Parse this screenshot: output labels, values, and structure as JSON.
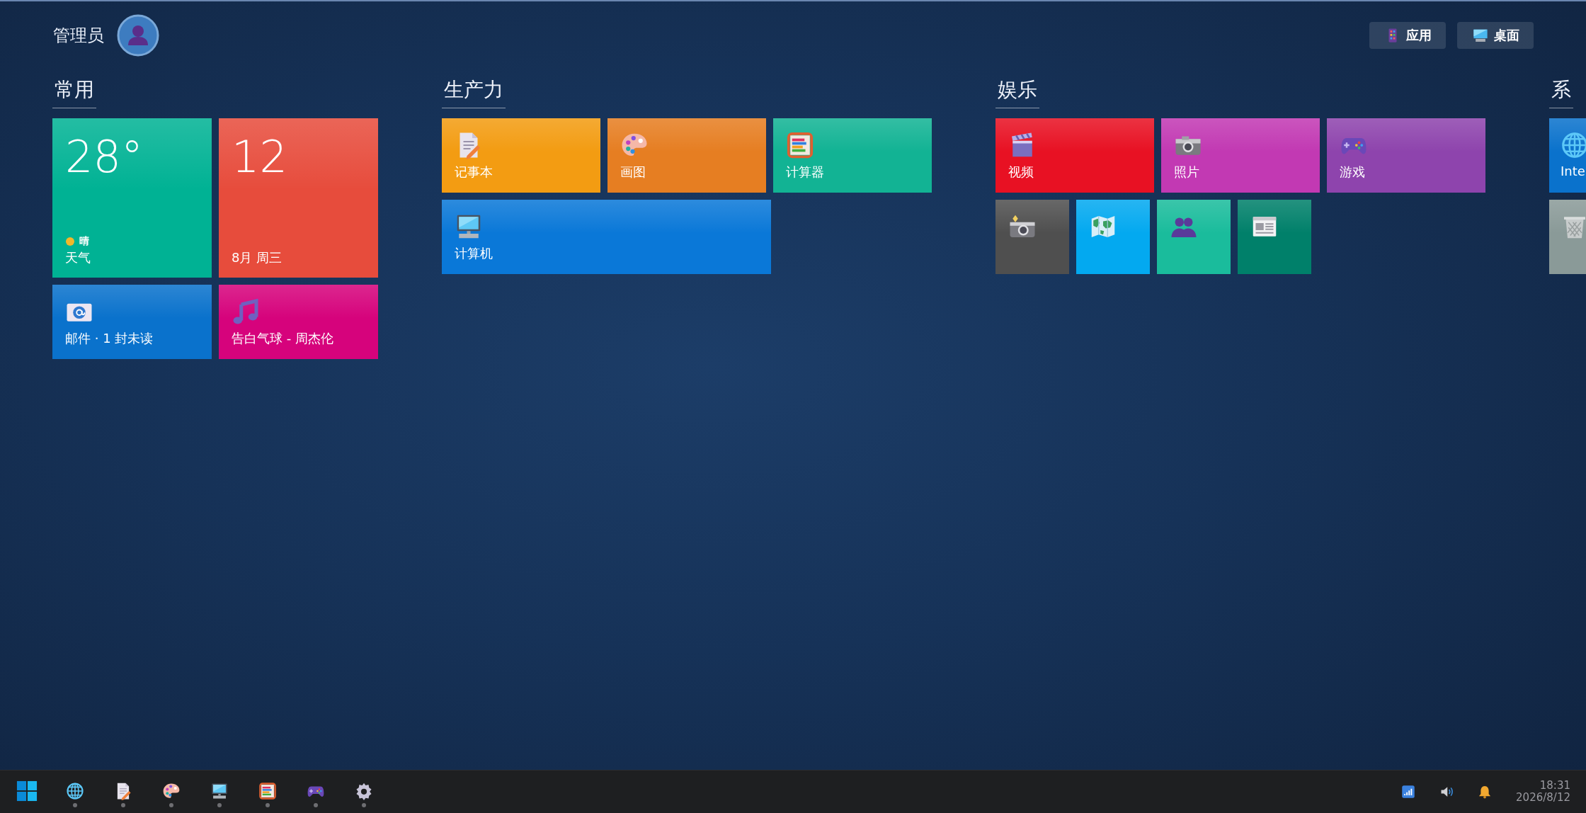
{
  "user": {
    "name": "管理员"
  },
  "top_buttons": [
    {
      "label": "应用",
      "kind": "apps"
    },
    {
      "label": "桌面",
      "kind": "desktop"
    }
  ],
  "groups": [
    {
      "title": "常用",
      "tiles": [
        {
          "kind": "weather",
          "tall": true,
          "double": false,
          "small": false,
          "color": "#00b294",
          "temperature": "28°",
          "condition": "晴",
          "label": "天气"
        },
        {
          "kind": "calendar",
          "tall": true,
          "double": false,
          "small": false,
          "color": "#e74c3c",
          "day": "12",
          "label": "8月 周三"
        },
        {
          "kind": "mail",
          "tall": false,
          "double": false,
          "small": false,
          "color": "#0a72cc",
          "label": "邮件 · 1 封未读"
        },
        {
          "kind": "music",
          "tall": false,
          "double": false,
          "small": false,
          "color": "#d6037c",
          "label": "告白气球 - 周杰伦"
        }
      ]
    },
    {
      "title": "生产力",
      "tiles": [
        {
          "kind": "notepad",
          "tall": false,
          "double": false,
          "small": false,
          "color": "#f39c12",
          "label": "记事本"
        },
        {
          "kind": "palette",
          "tall": false,
          "double": false,
          "small": false,
          "color": "#e67e22",
          "label": "画图"
        },
        {
          "kind": "abacus",
          "tall": false,
          "double": false,
          "small": false,
          "color": "#12b394",
          "label": "计算器"
        },
        {
          "kind": "computer",
          "tall": false,
          "double": true,
          "small": false,
          "color": "#0a78d8",
          "label": "计算机"
        }
      ]
    },
    {
      "title": "娱乐",
      "tiles": [
        {
          "kind": "clapper",
          "tall": false,
          "double": false,
          "small": false,
          "color": "#e81123",
          "label": "视频"
        },
        {
          "kind": "camera",
          "tall": false,
          "double": false,
          "small": false,
          "color": "#c239b3",
          "label": "照片"
        },
        {
          "kind": "gamepad",
          "tall": false,
          "double": false,
          "small": false,
          "color": "#8e44ad",
          "label": "游戏"
        },
        {
          "kind": "flashcamera",
          "tall": false,
          "double": false,
          "small": true,
          "color": "#4f4f4f"
        },
        {
          "kind": "map",
          "tall": false,
          "double": false,
          "small": true,
          "color": "#03a9f0"
        },
        {
          "kind": "people",
          "tall": false,
          "double": false,
          "small": true,
          "color": "#1abc9c"
        },
        {
          "kind": "news",
          "tall": false,
          "double": false,
          "small": true,
          "color": "#00806a"
        }
      ]
    },
    {
      "title": "系",
      "tiles": [
        {
          "kind": "globe",
          "tall": false,
          "color": "#0a72cc",
          "label": "Inte"
        },
        {
          "kind": "trash",
          "tall": false,
          "color": "#8a9a98"
        }
      ]
    }
  ],
  "taskbar": {
    "items": [
      {
        "kind": "start",
        "running": false
      },
      {
        "kind": "globe",
        "running": true
      },
      {
        "kind": "notepad",
        "running": true
      },
      {
        "kind": "palette",
        "running": true
      },
      {
        "kind": "computer",
        "running": true
      },
      {
        "kind": "abacus",
        "running": true
      },
      {
        "kind": "gamepad",
        "running": true
      },
      {
        "kind": "gear",
        "running": true
      }
    ],
    "tray": [
      {
        "kind": "signal"
      },
      {
        "kind": "speaker"
      },
      {
        "kind": "bell"
      }
    ],
    "time": "18:31",
    "date": "2026/8/12"
  }
}
